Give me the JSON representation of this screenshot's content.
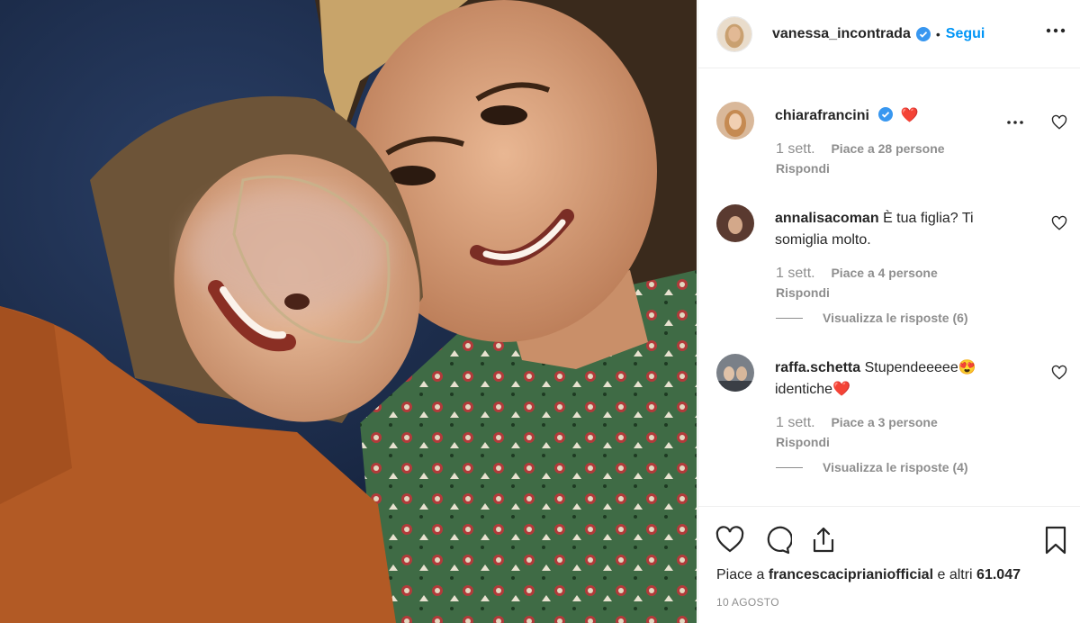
{
  "post": {
    "image_alt": "photo",
    "author": "vanessa_incontrada",
    "follow_label": "Segui",
    "separator": "•"
  },
  "comments": [
    {
      "user": "chiarafrancini",
      "text": "",
      "emoji": "❤️",
      "verified": true,
      "time": "1 sett.",
      "likes": "Piace a 28 persone",
      "reply": "Rispondi"
    },
    {
      "user": "annalisacoman",
      "text": "È tua figlia? Ti somiglia molto.",
      "time": "1 sett.",
      "likes": "Piace a 4 persone",
      "reply": "Rispondi",
      "view_replies": "Visualizza le risposte (6)"
    },
    {
      "user": "raffa.schetta",
      "text": "Stupendeeeee😍 identiche❤️",
      "time": "1 sett.",
      "likes": "Piace a 3 persone",
      "reply": "Rispondi",
      "view_replies": "Visualizza le risposte (4)"
    }
  ],
  "footer": {
    "likes_prefix": "Piace a",
    "likes_user": "francescaciprianiofficial",
    "likes_suffix": "e altri",
    "likes_count": "61.047",
    "date": "10 AGOSTO"
  },
  "icons": {
    "like": "heart-icon",
    "comment": "comment-icon",
    "share": "share-icon",
    "save": "bookmark-icon",
    "more": "more-icon",
    "verified": "verified-badge-icon"
  },
  "colors": {
    "accent": "#0095f6",
    "text": "#262626",
    "muted": "#8e8e8e",
    "heart": "#ed4956"
  }
}
